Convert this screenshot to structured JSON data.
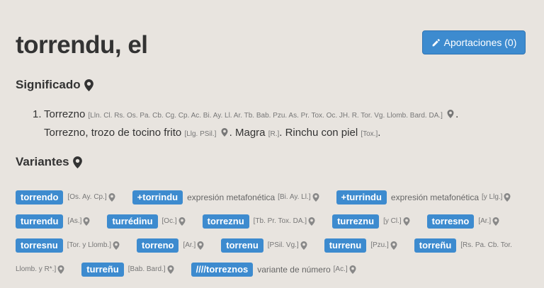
{
  "headword": "torrendu, el",
  "contrib_button": "Aportaciones (0)",
  "sections": {
    "significado": "Significado",
    "variantes": "Variantes"
  },
  "meaning": {
    "number": "1.",
    "line1_word": "Torrezno",
    "line1_sources": "[Lln. Cl. Rs. Os. Pa. Cb. Cg. Cp. Ac. Bi. Ay. Ll. Ar. Tb. Bab. Pzu. As. Pr. Tox. Oc. JH. R. Tor. Vg. Llomb. Bard. DA.]",
    "line2_text": "Torrezno, trozo de tocino frito",
    "line2_sources": "[Llg. PSil.]",
    "line2_text2": "Magra",
    "line2_sources2": "[R.]",
    "line2_text3": "Rinchu con piel",
    "line2_sources3": "[Tox.]"
  },
  "variants": [
    {
      "tag": "torrendo",
      "desc": "",
      "src": "[Os. Ay. Cp.]"
    },
    {
      "tag": "+torrindu",
      "desc": "expresión metafonética",
      "src": "[Bi. Ay. Ll.]"
    },
    {
      "tag": "+turrindu",
      "desc": "expresión metafonética",
      "src": "[y Llg.]"
    },
    {
      "tag": "turrendu",
      "desc": "",
      "src": "[As.]"
    },
    {
      "tag": "turrédinu",
      "desc": "",
      "src": "[Oc.]"
    },
    {
      "tag": "torreznu",
      "desc": "",
      "src": "[Tb. Pr. Tox. DA.]"
    },
    {
      "tag": "turreznu",
      "desc": "",
      "src": "[y Cl.]"
    },
    {
      "tag": "torresno",
      "desc": "",
      "src": "[Ar.]"
    },
    {
      "tag": "torresnu",
      "desc": "",
      "src": "[Tor. y Llomb.]"
    },
    {
      "tag": "torreno",
      "desc": "",
      "src": "[Ar.]"
    },
    {
      "tag": "torrenu",
      "desc": "",
      "src": "[PSil. Vg.]"
    },
    {
      "tag": "turrenu",
      "desc": "",
      "src": "[Pzu.]"
    },
    {
      "tag": "torreñu",
      "desc": "",
      "src": "[Rs. Pa. Cb. Tor."
    },
    {
      "tag": "",
      "desc": "",
      "src": "Llomb. y R*.]"
    },
    {
      "tag": "turreñu",
      "desc": "",
      "src": "[Bab. Bard.]"
    },
    {
      "tag": "////torreznos",
      "desc": "variante de número",
      "src": "[Ac.]"
    }
  ]
}
